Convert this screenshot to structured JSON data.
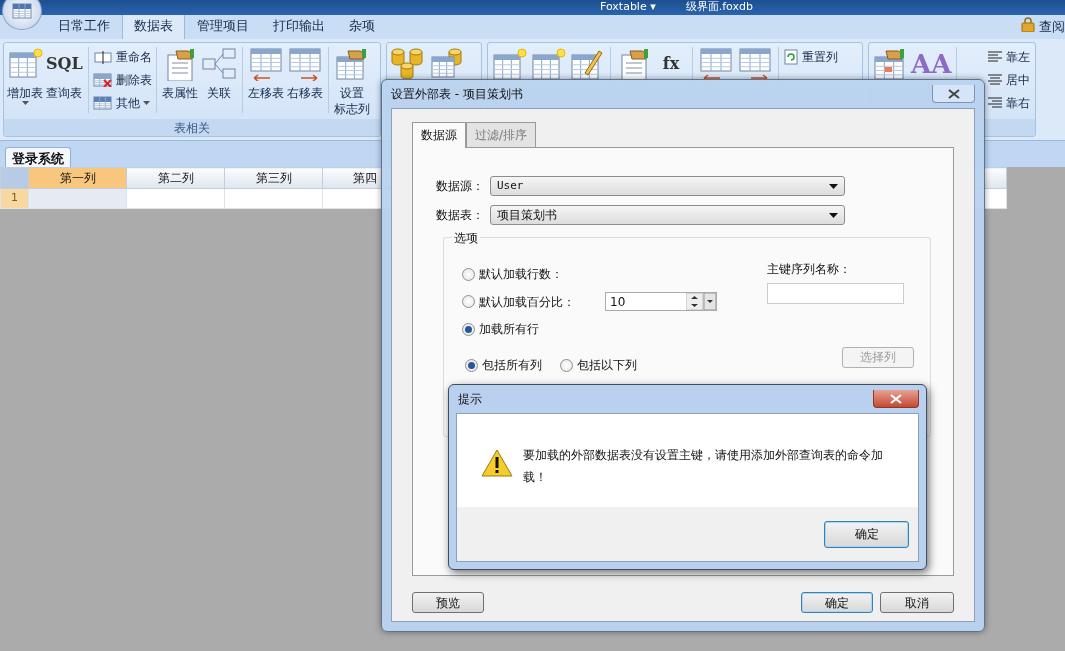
{
  "title_bar": {
    "title": "Foxtable ▾",
    "file": "级界面.foxdb"
  },
  "ribbon": {
    "tabs": [
      {
        "label": "日常工作",
        "selected": false
      },
      {
        "label": "数据表",
        "selected": true
      },
      {
        "label": "管理项目",
        "selected": false
      },
      {
        "label": "打印输出",
        "selected": false
      },
      {
        "label": "杂项",
        "selected": false
      }
    ],
    "right_link": "查阅",
    "groups": [
      {
        "label": "表相关",
        "items": [
          {
            "kind": "large",
            "label_lines": [
              "增加表"
            ],
            "dropdown": true
          },
          {
            "kind": "large",
            "icon_text": "SQL",
            "label_lines": [
              "查询表"
            ]
          },
          {
            "kind": "stack",
            "entries": [
              {
                "label": "重命名"
              },
              {
                "label": "删除表"
              },
              {
                "label": "其他",
                "dropdown": true
              }
            ]
          },
          {
            "kind": "large",
            "label_lines": [
              "表属性"
            ]
          },
          {
            "kind": "large",
            "label_lines": [
              "关联"
            ]
          },
          {
            "kind": "large",
            "label_lines": [
              "左移表"
            ]
          },
          {
            "kind": "large",
            "label_lines": [
              "右移表"
            ]
          },
          {
            "kind": "large",
            "label_lines": [
              "设置",
              "标志列"
            ]
          }
        ]
      },
      {
        "items": [
          {
            "kind": "large"
          },
          {
            "kind": "large"
          }
        ]
      },
      {
        "items": [
          {
            "kind": "large"
          },
          {
            "kind": "large"
          },
          {
            "kind": "large"
          },
          {
            "kind": "large"
          },
          {
            "kind": "large",
            "icon_text": "fx"
          },
          {
            "kind": "large"
          },
          {
            "kind": "large"
          },
          {
            "kind": "stack",
            "entries": [
              {
                "label": "重置列"
              }
            ]
          }
        ]
      },
      {
        "items": [
          {
            "kind": "large"
          },
          {
            "kind": "large",
            "icon_text": "AA"
          },
          {
            "kind": "stack",
            "entries": [
              {
                "label": "靠左"
              },
              {
                "label": "居中"
              },
              {
                "label": "靠右"
              }
            ]
          }
        ]
      }
    ]
  },
  "sheet_tabs": [
    {
      "label": "登录系统",
      "selected": true
    }
  ],
  "grid": {
    "columns": [
      {
        "label": "第一列",
        "selected": true
      },
      {
        "label": "第二列",
        "selected": false
      },
      {
        "label": "第三列",
        "selected": false
      },
      {
        "label": "第四",
        "selected": false
      }
    ],
    "rows": [
      {
        "header": "1",
        "selected": true
      }
    ]
  },
  "dialog": {
    "title": "设置外部表 - 项目策划书",
    "tabs": [
      {
        "label": "数据源",
        "selected": true
      },
      {
        "label": "过滤/排序",
        "selected": false
      }
    ],
    "fields": [
      {
        "label": "数据源：",
        "value": "User"
      },
      {
        "label": "数据表：",
        "value": "项目策划书"
      }
    ],
    "options": {
      "legend": "选项",
      "load_radios": [
        {
          "label": "默认加载行数：",
          "selected": false
        },
        {
          "label": "默认加载百分比：",
          "selected": false
        },
        {
          "label": "加载所有行",
          "selected": true
        }
      ],
      "spin_value": "10",
      "key_label": "主键序列名称：",
      "column_radios": [
        {
          "label": "包括所有列",
          "selected": true
        },
        {
          "label": "包括以下列",
          "selected": false
        }
      ],
      "select_button": {
        "label": "选择列",
        "disabled": true
      }
    },
    "buttons": [
      {
        "label": "预览",
        "default": false
      },
      {
        "label": "确定",
        "default": true
      },
      {
        "label": "取消",
        "default": false
      }
    ]
  },
  "alert": {
    "title": "提示",
    "message": "要加载的外部数据表没有设置主键，请使用添加外部查询表的命令加载！",
    "button": "确定"
  }
}
